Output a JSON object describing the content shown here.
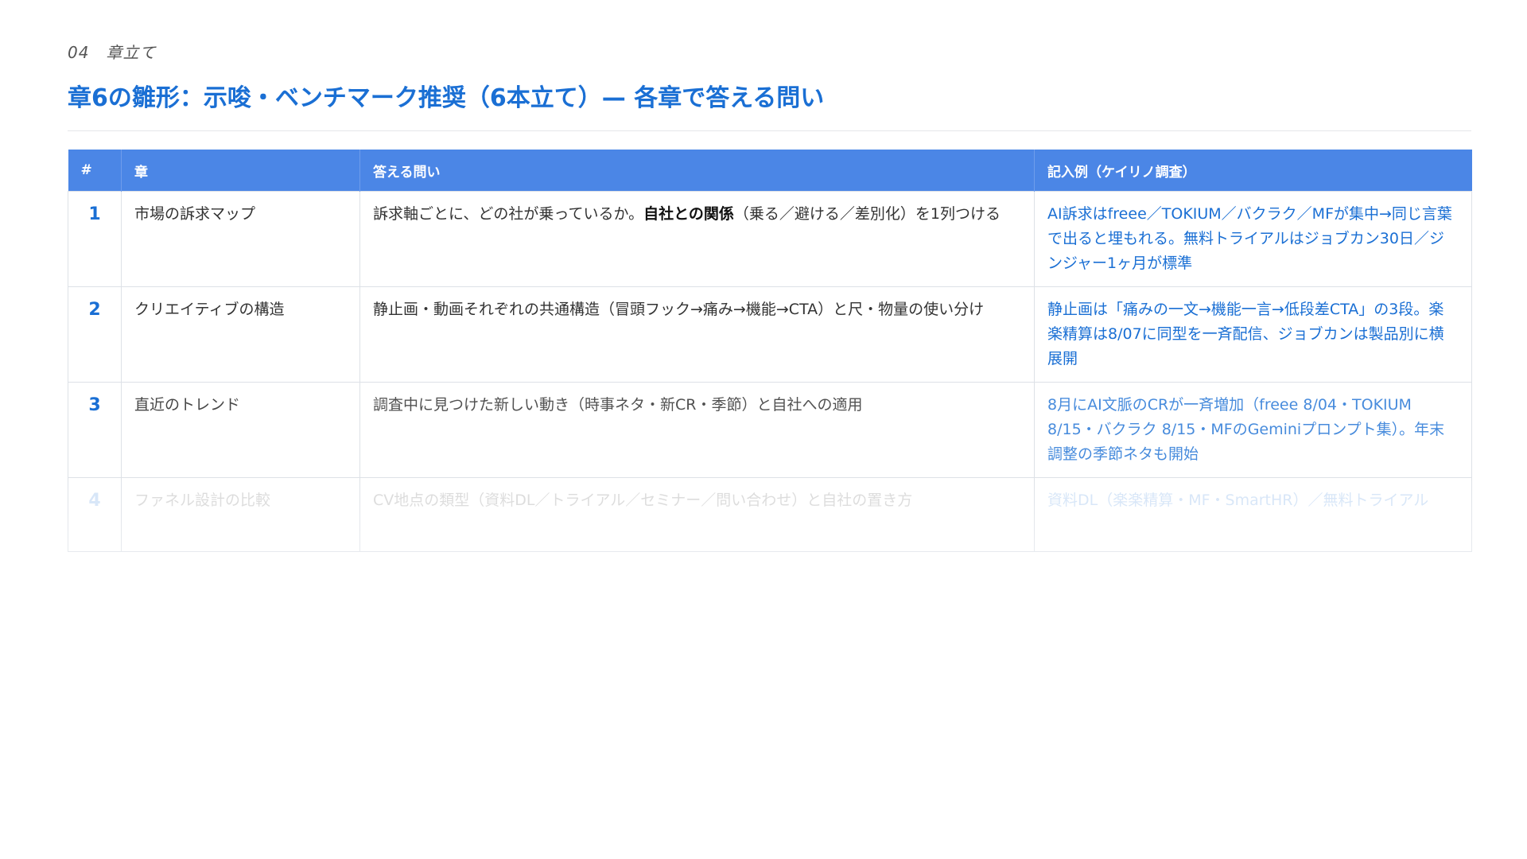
{
  "section": {
    "eyebrow": "04　章立て"
  },
  "header": {
    "title": "章6の雛形：示唆・ベンチマーク推奨（6本立て）— 各章で答える問い"
  },
  "table": {
    "columns": [
      "#",
      "章",
      "答える問い",
      "記入例（ケイリノ調査）"
    ],
    "rows": [
      {
        "num": "1",
        "chapter": "市場の訴求マップ",
        "question_pre": "訴求軸ごとに、どの社が乗っているか。",
        "question_bold": "自社との関係",
        "question_post": "（乗る／避ける／差別化）を1列つける",
        "example": "AI訴求はfreee／TOKIUM／バクラク／MFが集中→同じ言葉で出ると埋もれる。無料トライアルはジョブカン30日／ジンジャー1ヶ月が標準"
      },
      {
        "num": "2",
        "chapter": "クリエイティブの構造",
        "question_pre": "静止画・動画それぞれの共通構造（冒頭フック→痛み→機能→CTA）と尺・物量の使い分け",
        "question_bold": "",
        "question_post": "",
        "example": "静止画は「痛みの一文→機能一言→低段差CTA」の3段。楽楽精算は8/07に同型を一斉配信、ジョブカンは製品別に横展開"
      },
      {
        "num": "3",
        "chapter": "直近のトレンド",
        "question_pre": "調査中に見つけた新しい動き（時事ネタ・新CR・季節）と自社への適用",
        "question_bold": "",
        "question_post": "",
        "example": "8月にAI文脈のCRが一斉増加（freee 8/04・TOKIUM 8/15・バクラク 8/15・MFのGeminiプロンプト集）。年末調整の季節ネタも開始"
      },
      {
        "num": "4",
        "chapter": "ファネル設計の比較",
        "question_pre": "CV地点の類型（資料DL／トライアル／セミナー／問い合わせ）と自社の置き方",
        "question_bold": "",
        "question_post": "",
        "example": "資料DL（楽楽精算・MF・SmartHR）／無料トライアル"
      }
    ]
  }
}
